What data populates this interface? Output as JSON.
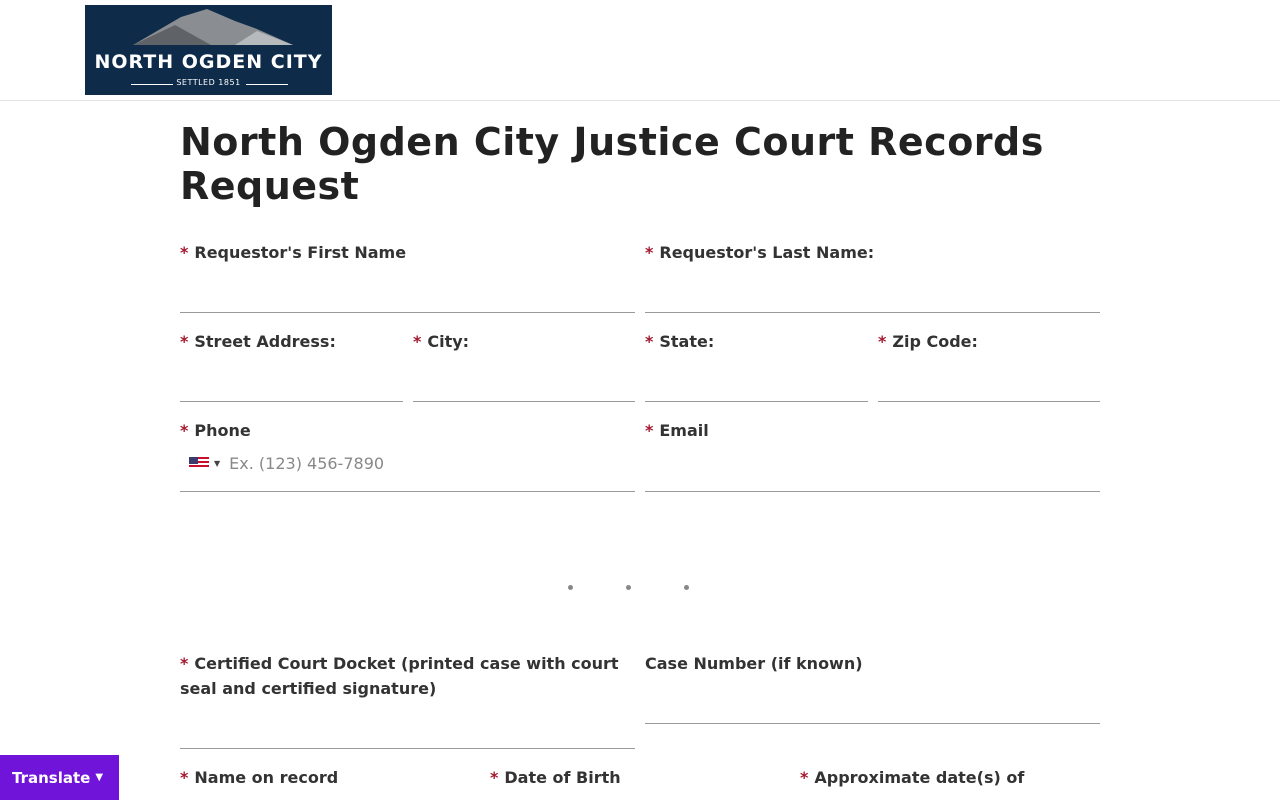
{
  "logo": {
    "name": "NORTH OGDEN CITY",
    "tagline": "SETTLED 1851"
  },
  "page_title": "North Ogden City Justice Court Records Request",
  "required_marker": "*",
  "fields": {
    "first_name": {
      "label": "Requestor's First Name",
      "value": ""
    },
    "last_name": {
      "label": "Requestor's Last Name:",
      "value": ""
    },
    "street": {
      "label": "Street Address:",
      "value": ""
    },
    "city": {
      "label": "City:",
      "value": ""
    },
    "state": {
      "label": "State:",
      "value": ""
    },
    "zip": {
      "label": "Zip Code:",
      "value": ""
    },
    "phone": {
      "label": "Phone",
      "placeholder": "Ex. (123) 456-7890",
      "country": "us-flag-icon",
      "value": ""
    },
    "email": {
      "label": "Email",
      "value": ""
    },
    "docket": {
      "label": "Certified Court Docket (printed case with court seal and certified signature)",
      "value": ""
    },
    "case_number": {
      "label": "Case Number (if known)",
      "value": ""
    },
    "name_on_record": {
      "label": "Name on record"
    },
    "dob": {
      "label": "Date of Birth"
    },
    "approx_dates": {
      "label": "Approximate date(s) of"
    }
  },
  "translate": {
    "label": "Translate",
    "icon": "chevron-down-icon"
  },
  "colors": {
    "required": "#a3192f",
    "translate_bg": "#7114d9",
    "logo_bg": "#0e2b49"
  }
}
